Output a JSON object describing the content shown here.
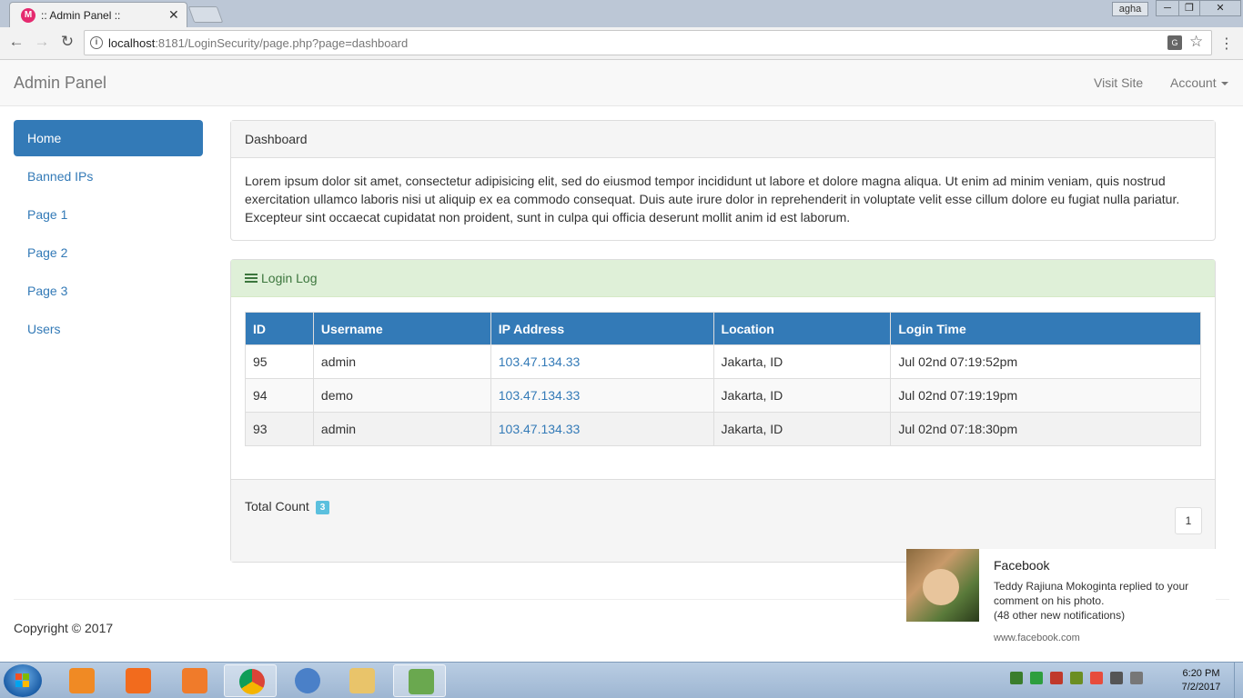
{
  "browser": {
    "tab_title": ":: Admin Panel ::",
    "tab_close": "✕",
    "user": "agha",
    "url_host": "localhost",
    "url_rest": ":8181/LoginSecurity/page.php?page=dashboard",
    "icons": {
      "back": "arrow-left-icon",
      "forward": "arrow-right-icon",
      "reload": "reload-icon",
      "info": "info-icon",
      "translate": "translate-icon",
      "star": "star-icon",
      "menu": "kebab-menu-icon"
    }
  },
  "navbar": {
    "brand": "Admin Panel",
    "visit_site": "Visit Site",
    "account": "Account"
  },
  "sidebar": {
    "items": [
      {
        "label": "Home",
        "active": true
      },
      {
        "label": "Banned IPs"
      },
      {
        "label": "Page 1"
      },
      {
        "label": "Page 2"
      },
      {
        "label": "Page 3"
      },
      {
        "label": "Users"
      }
    ]
  },
  "dashboard": {
    "heading": "Dashboard",
    "body": "Lorem ipsum dolor sit amet, consectetur adipisicing elit, sed do eiusmod tempor incididunt ut labore et dolore magna aliqua. Ut enim ad minim veniam, quis nostrud exercitation ullamco laboris nisi ut aliquip ex ea commodo consequat. Duis aute irure dolor in reprehenderit in voluptate velit esse cillum dolore eu fugiat nulla pariatur. Excepteur sint occaecat cupidatat non proident, sunt in culpa qui officia deserunt mollit anim id est laborum."
  },
  "login_log": {
    "heading": "Login Log",
    "columns": [
      "ID",
      "Username",
      "IP Address",
      "Location",
      "Login Time"
    ],
    "rows": [
      [
        "95",
        "admin",
        "103.47.134.33",
        "Jakarta, ID",
        "Jul 02nd 07:19:52pm"
      ],
      [
        "94",
        "demo",
        "103.47.134.33",
        "Jakarta, ID",
        "Jul 02nd 07:19:19pm"
      ],
      [
        "93",
        "admin",
        "103.47.134.33",
        "Jakarta, ID",
        "Jul 02nd 07:18:30pm"
      ]
    ],
    "total_label": "Total Count",
    "total_count": "3",
    "page": "1"
  },
  "footer": {
    "copyright": "Copyright © 2017"
  },
  "notification": {
    "title": "Facebook",
    "line1": "Teddy Rajiuna Mokoginta replied to your comment on his photo.",
    "line2": "(48 other new notifications)",
    "site": "www.facebook.com"
  },
  "taskbar": {
    "time": "6:20 PM",
    "date": "7/2/2017"
  },
  "colors": {
    "primary": "#337ab7",
    "success_bg": "#dff0d8",
    "success_text": "#3c763d",
    "badge": "#5bc0de"
  }
}
